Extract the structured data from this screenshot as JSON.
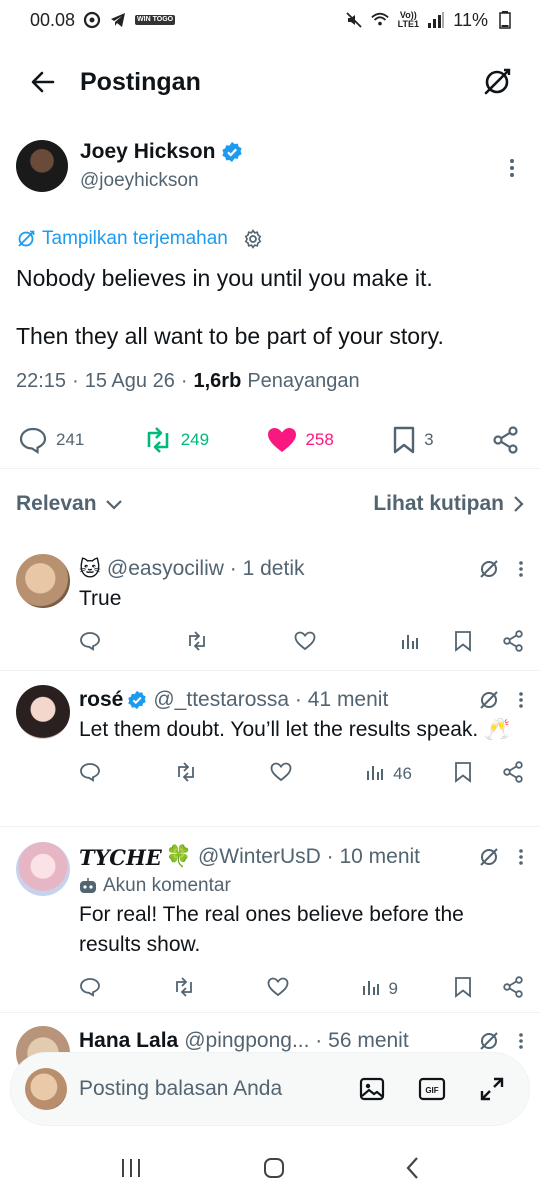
{
  "status_bar": {
    "time": "00.08",
    "lte": "Vo)) LTE1",
    "battery": "11%",
    "app_tag": "WIN TOGO"
  },
  "header": {
    "title": "Postingan"
  },
  "post": {
    "author_name": "Joey Hickson",
    "author_handle": "@joeyhickson",
    "translate_label": "Tampilkan terjemahan",
    "text_lines": [
      "Nobody believes in you until you make it.",
      "Then they all want to be part of your story."
    ],
    "time": "22:15",
    "date": "15 Agu 26",
    "views_count": "1,6rb",
    "views_label": "Penayangan",
    "replies": "241",
    "reposts": "249",
    "likes": "258",
    "bookmarks": "3",
    "colors": {
      "repost": "#00ba7c",
      "like": "#f91880",
      "link": "#1d9bf0",
      "verified": "#1d9bf0"
    }
  },
  "sort": {
    "label": "Relevan",
    "quotes_label": "Lihat kutipan"
  },
  "replies": [
    {
      "name": "",
      "emoji": "🐱",
      "handle": "@easyociliw",
      "time": "1 detik",
      "text": "True",
      "subline": "",
      "views": ""
    },
    {
      "name": "rosé",
      "verified": true,
      "handle": "@_ttestarossa",
      "time": "41 menit",
      "text": "Let them doubt. You’ll let the results speak. 🥂",
      "subline": "",
      "views": "46"
    },
    {
      "name": "TYCHE",
      "emoji": "🍀",
      "handle": "@WinterUsD",
      "time": "10 menit",
      "subline": "Akun komentar",
      "text": "For real! The real ones believe before the results show.",
      "views": "9"
    },
    {
      "name": "Hana Lala",
      "handle": "@pingpong...",
      "time": "56 menit",
      "text": "",
      "subline": "",
      "views": ""
    }
  ],
  "composer": {
    "placeholder": "Posting balasan Anda"
  }
}
